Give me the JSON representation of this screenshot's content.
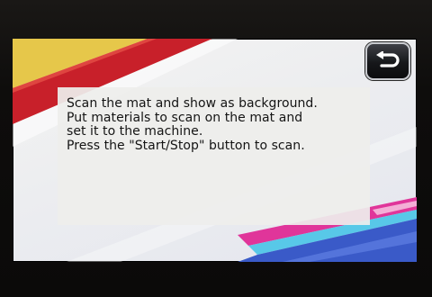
{
  "screen": {
    "back_button": {
      "icon": "return-arrow-icon",
      "label": ""
    },
    "message": {
      "lines": [
        "Scan the mat and show as background.",
        "Put materials to scan on the mat and",
        "set it to the machine.",
        "Press the \"Start/Stop\" button to scan."
      ]
    }
  },
  "colors": {
    "bezel": "#0d0c0b",
    "screen_background": "#f0f0f1",
    "accent_yellow": "#e6c74a",
    "accent_red": "#c8202a",
    "accent_magenta": "#e0359a",
    "accent_blue": "#3a5ac8",
    "dialog_background": "#eeeeec",
    "text": "#141414"
  }
}
